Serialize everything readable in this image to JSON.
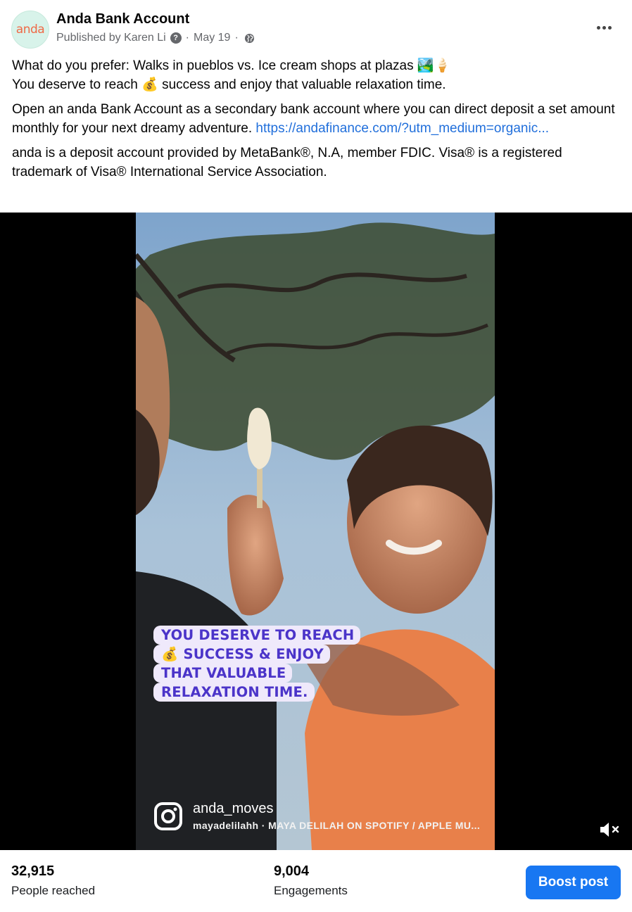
{
  "header": {
    "avatar_text": "anda",
    "page_name": "Anda Bank Account",
    "published_by": "Published by Karen Li",
    "help_icon_glyph": "?",
    "date": "May 19",
    "dot": "·",
    "more_icon": "more-horizontal-icon",
    "privacy_icon": "globe-icon"
  },
  "post": {
    "line1": "What do you prefer: Walks in pueblos vs. Ice cream shops at plazas 🏞️🍦",
    "line2_before": "You deserve to reach ",
    "line2_emoji": "💰",
    "line2_after": " success and enjoy that valuable relaxation time.",
    "para2_text": "Open an anda Bank Account as a secondary bank account where you can direct deposit a set amount monthly for your next dreamy adventure. ",
    "para2_link": "https://andafinance.com/?utm_medium=organic...",
    "para3_text": "anda is a deposit account provided by MetaBank®, N.A, member FDIC. Visa® is a registered trademark of Visa® International Service Association."
  },
  "video": {
    "caption_lines": [
      "YOU DESERVE TO REACH",
      "💰 SUCCESS & ENJOY",
      "THAT VALUABLE",
      "RELAXATION TIME."
    ],
    "ig_handle": "anda_moves",
    "ig_music": "mayadelilahh · MAYA DELILAH ON SPOTIFY / APPLE MU...",
    "caption_color": "#4b34c9",
    "mute_icon": "muted-speaker-icon"
  },
  "stats": {
    "reached_value": "32,915",
    "reached_label": "People reached",
    "engagements_value": "9,004",
    "engagements_label": "Engagements",
    "boost_label": "Boost post",
    "boost_color": "#1877f2"
  }
}
